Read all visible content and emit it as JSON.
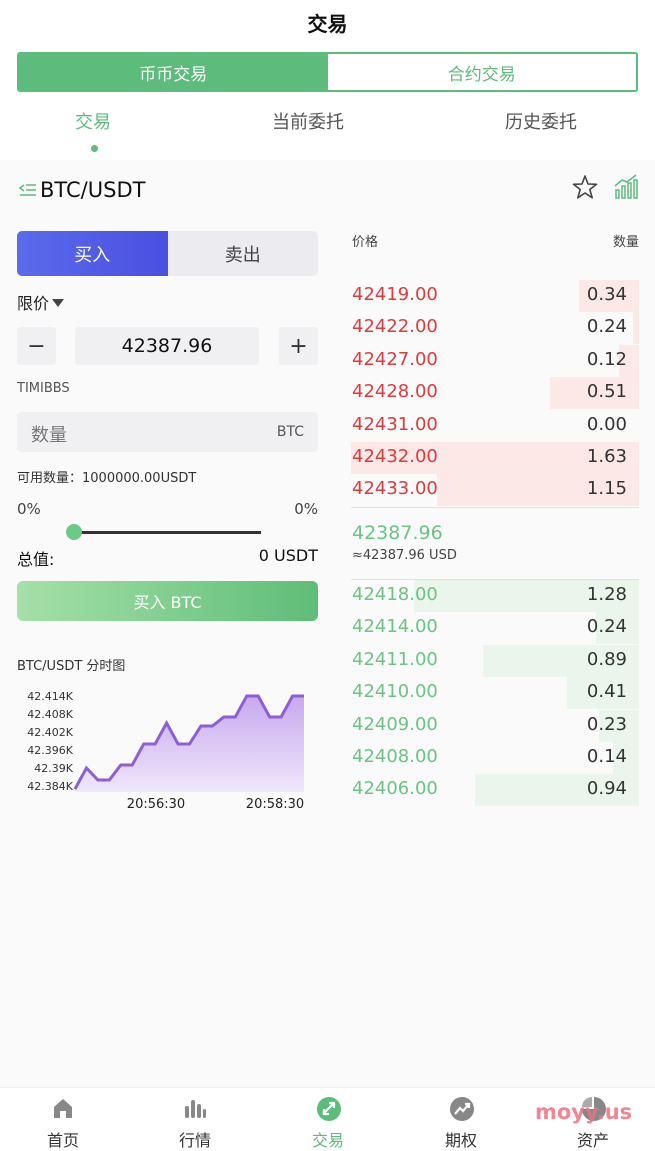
{
  "header": {
    "title": "交易"
  },
  "segment": {
    "spot": "币币交易",
    "contract": "合约交易"
  },
  "tabs": [
    {
      "label": "交易"
    },
    {
      "label": "当前委托"
    },
    {
      "label": "历史委托"
    }
  ],
  "pair": {
    "name": "BTC/USDT"
  },
  "order_form": {
    "buy_label": "买入",
    "sell_label": "卖出",
    "order_type": "限价",
    "minus": "−",
    "price": "42387.96",
    "plus": "+",
    "account": "TIMIBBS",
    "qty_placeholder": "数量",
    "qty_unit": "BTC",
    "available": "可用数量：1000000.00USDT",
    "pct_left": "0%",
    "pct_right": "0%",
    "slider_value": 0,
    "total_label": "总值:",
    "total_value": "0 USDT",
    "submit_label": "买入 BTC"
  },
  "mini_chart": {
    "title": "BTC/USDT 分时图",
    "ytick_labels": [
      "42.414K",
      "42.408K",
      "42.402K",
      "42.396K",
      "42.39K",
      "42.384K"
    ],
    "xtick_labels": [
      "20:56:30",
      "20:58:30"
    ]
  },
  "chart_data": {
    "type": "area",
    "title": "BTC/USDT 分时图",
    "xlabel": "",
    "ylabel": "",
    "ylim": [
      42382,
      42416
    ],
    "yticks": [
      42414,
      42408,
      42402,
      42396,
      42390,
      42384
    ],
    "xticks": [
      "20:56:30",
      "20:58:30"
    ],
    "series": [
      {
        "values": [
          42383,
          42390,
          42386,
          42386,
          42391,
          42391,
          42398,
          42398,
          42405,
          42398,
          42398,
          42404,
          42404,
          42407,
          42407,
          42414,
          42414,
          42407,
          42407,
          42414,
          42414
        ]
      }
    ],
    "grid": false,
    "legend": "none",
    "colors": {
      "line": "#8b5fd6",
      "fill_top": "#c8a8ee",
      "fill_bottom": "#eee4fb"
    }
  },
  "orderbook": {
    "price_header": "价格",
    "qty_header": "数量",
    "asks": [
      {
        "price": "42419.00",
        "qty": "0.34",
        "depth": 0.21
      },
      {
        "price": "42422.00",
        "qty": "0.24",
        "depth": 0.02
      },
      {
        "price": "42427.00",
        "qty": "0.12",
        "depth": 0.07
      },
      {
        "price": "42428.00",
        "qty": "0.51",
        "depth": 0.31
      },
      {
        "price": "42431.00",
        "qty": "0.00",
        "depth": 0.0
      },
      {
        "price": "42432.00",
        "qty": "1.63",
        "depth": 1.0
      },
      {
        "price": "42433.00",
        "qty": "1.15",
        "depth": 0.7
      }
    ],
    "last_price": "42387.96",
    "last_usd": "≈42387.96 USD",
    "bids": [
      {
        "price": "42418.00",
        "qty": "1.28",
        "depth": 0.78
      },
      {
        "price": "42414.00",
        "qty": "0.24",
        "depth": 0.15
      },
      {
        "price": "42411.00",
        "qty": "0.89",
        "depth": 0.54
      },
      {
        "price": "42410.00",
        "qty": "0.41",
        "depth": 0.25
      },
      {
        "price": "42409.00",
        "qty": "0.23",
        "depth": 0.14
      },
      {
        "price": "42408.00",
        "qty": "0.14",
        "depth": 0.09
      },
      {
        "price": "42406.00",
        "qty": "0.94",
        "depth": 0.57
      }
    ]
  },
  "bottom_nav": [
    {
      "label": "首页",
      "icon": "home-icon"
    },
    {
      "label": "行情",
      "icon": "market-icon"
    },
    {
      "label": "交易",
      "icon": "trade-icon"
    },
    {
      "label": "期权",
      "icon": "options-icon"
    },
    {
      "label": "资产",
      "icon": "assets-icon"
    }
  ],
  "watermark": "moyy.us",
  "colors": {
    "accent": "#5dbb7c",
    "buy": "#4a4fe0",
    "ask": "#e23a3a",
    "bid": "#6cc483"
  }
}
